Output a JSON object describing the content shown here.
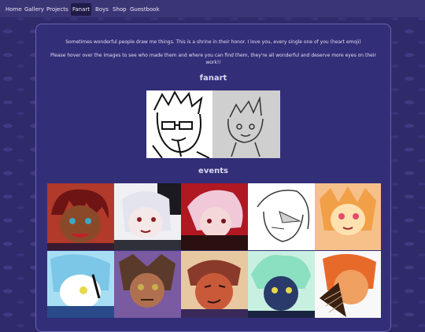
{
  "nav": {
    "items": [
      {
        "label": "Home"
      },
      {
        "label": "Gallery"
      },
      {
        "label": "Projects"
      },
      {
        "label": "Fanart",
        "active": true
      },
      {
        "label": "Boys"
      },
      {
        "label": "Shop"
      },
      {
        "label": "Guestbook"
      }
    ]
  },
  "intro": {
    "line1": "Sometimes wonderful people draw me things. This is a shrine in their honor. I love you, every single one of you (heart emoji)",
    "line2": "Please hover over the images to see who made them and where you can find them, they're all wonderful and deserve more eyes on their work!!"
  },
  "sections": {
    "fanart_title": "fanart",
    "events_title": "events"
  },
  "fanart_images": [
    {
      "id": "fanart-1",
      "style": "ink sketch"
    },
    {
      "id": "fanart-2",
      "style": "pencil sketch"
    }
  ],
  "event_images": [
    {
      "id": "event-1",
      "palette": [
        "#6e1414",
        "#c24a2c",
        "#3aa8c8"
      ]
    },
    {
      "id": "event-2",
      "palette": [
        "#e8e8ee",
        "#8a2020",
        "#30303a"
      ]
    },
    {
      "id": "event-3",
      "palette": [
        "#b01822",
        "#f0c8d8",
        "#2a1010"
      ]
    },
    {
      "id": "event-4",
      "palette": [
        "#ffffff",
        "#d0d0d0",
        "#3a3a3a"
      ]
    },
    {
      "id": "event-5",
      "palette": [
        "#f2a048",
        "#e84a6a",
        "#ffe2b0"
      ]
    },
    {
      "id": "event-6",
      "palette": [
        "#7cc6e8",
        "#ffffff",
        "#2a4a8a"
      ]
    },
    {
      "id": "event-7",
      "palette": [
        "#5a3a2a",
        "#c8b050",
        "#7a5aa0"
      ]
    },
    {
      "id": "event-8",
      "palette": [
        "#c85a3a",
        "#e8c8a0",
        "#3a2a5a"
      ]
    },
    {
      "id": "event-9",
      "palette": [
        "#8ae0c0",
        "#2a3a6a",
        "#e8d84a"
      ]
    },
    {
      "id": "event-10",
      "palette": [
        "#e86a2a",
        "#f8f8f8",
        "#3a2010"
      ]
    }
  ],
  "colors": {
    "background": "#2f2a6a",
    "panel": "#332e78",
    "nav_bar": "#3a3575",
    "nav_active": "#201c48"
  }
}
